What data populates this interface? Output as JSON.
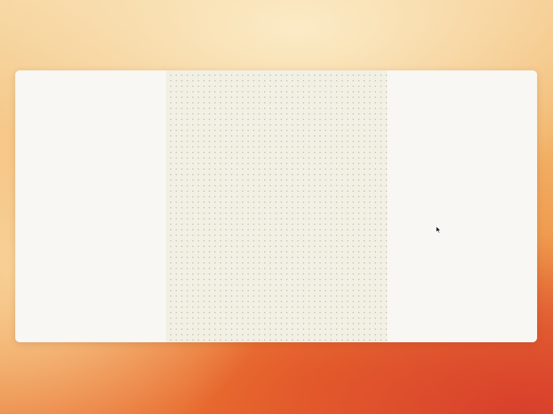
{
  "background": {
    "colors": [
      "#fbebc6",
      "#f2b46a",
      "#ee9548",
      "#e4602c",
      "#d8402c"
    ]
  },
  "window": {
    "background_color": "#f8f7f3",
    "panels": [
      {
        "name": "left-panel",
        "color": "#f8f7f3"
      },
      {
        "name": "canvas-panel",
        "color": "#f2f0e4",
        "pattern": "dot-grid"
      },
      {
        "name": "right-panel",
        "color": "#f8f7f3"
      }
    ]
  },
  "cursor": {
    "icon": "arrow-pointer-icon"
  }
}
